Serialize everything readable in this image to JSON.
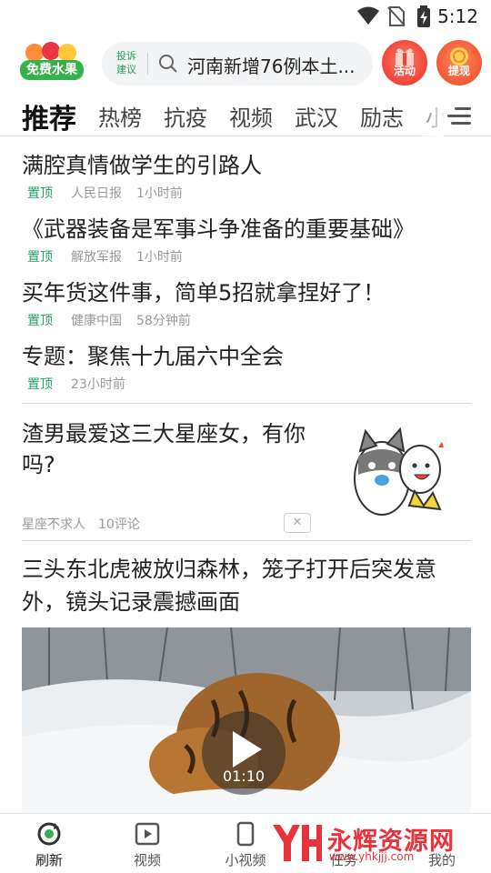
{
  "status_bar": {
    "time": "5:12"
  },
  "header": {
    "logo_text": "免费水果",
    "complaint_label": "投诉建议",
    "search_text": "河南新增76例本土...",
    "activity_label": "活动",
    "cashout_label": "提现"
  },
  "tabs": [
    "推荐",
    "热榜",
    "抗疫",
    "视频",
    "武汉",
    "励志",
    "小"
  ],
  "pinned": [
    {
      "title": "满腔真情做学生的引路人",
      "tag": "置顶",
      "source": "人民日报",
      "time": "1小时前"
    },
    {
      "title": "《武器装备是军事斗争准备的重要基础》",
      "tag": "置顶",
      "source": "解放军报",
      "time": "1小时前"
    },
    {
      "title": "买年货这件事，简单5招就拿捏好了！",
      "tag": "置顶",
      "source": "健康中国",
      "time": "58分钟前"
    },
    {
      "title": "专题：聚焦十九届六中全会",
      "tag": "置顶",
      "source": "",
      "time": "23小时前"
    }
  ],
  "star_article": {
    "title": "渣男最爱这三大星座女，有你吗?",
    "source": "星座不求人",
    "comments": "10评论",
    "close": "✕"
  },
  "video_article": {
    "title": "三头东北虎被放归森林，笼子打开后突发意外，镜头记录震撼画面",
    "duration": "01:10"
  },
  "bottom_nav": [
    {
      "label": "刷新",
      "icon": "refresh-icon"
    },
    {
      "label": "视频",
      "icon": "video-icon"
    },
    {
      "label": "小视频",
      "icon": "short-video-icon"
    },
    {
      "label": "任务",
      "icon": "task-icon"
    },
    {
      "label": "我的",
      "icon": "profile-icon"
    }
  ],
  "watermark": {
    "text": "永辉资源网",
    "url": "www.yhkjjj.com"
  },
  "colors": {
    "accent_green": "#22a061",
    "activity_red": "#f04436",
    "watermark_red": "#e8323c"
  }
}
